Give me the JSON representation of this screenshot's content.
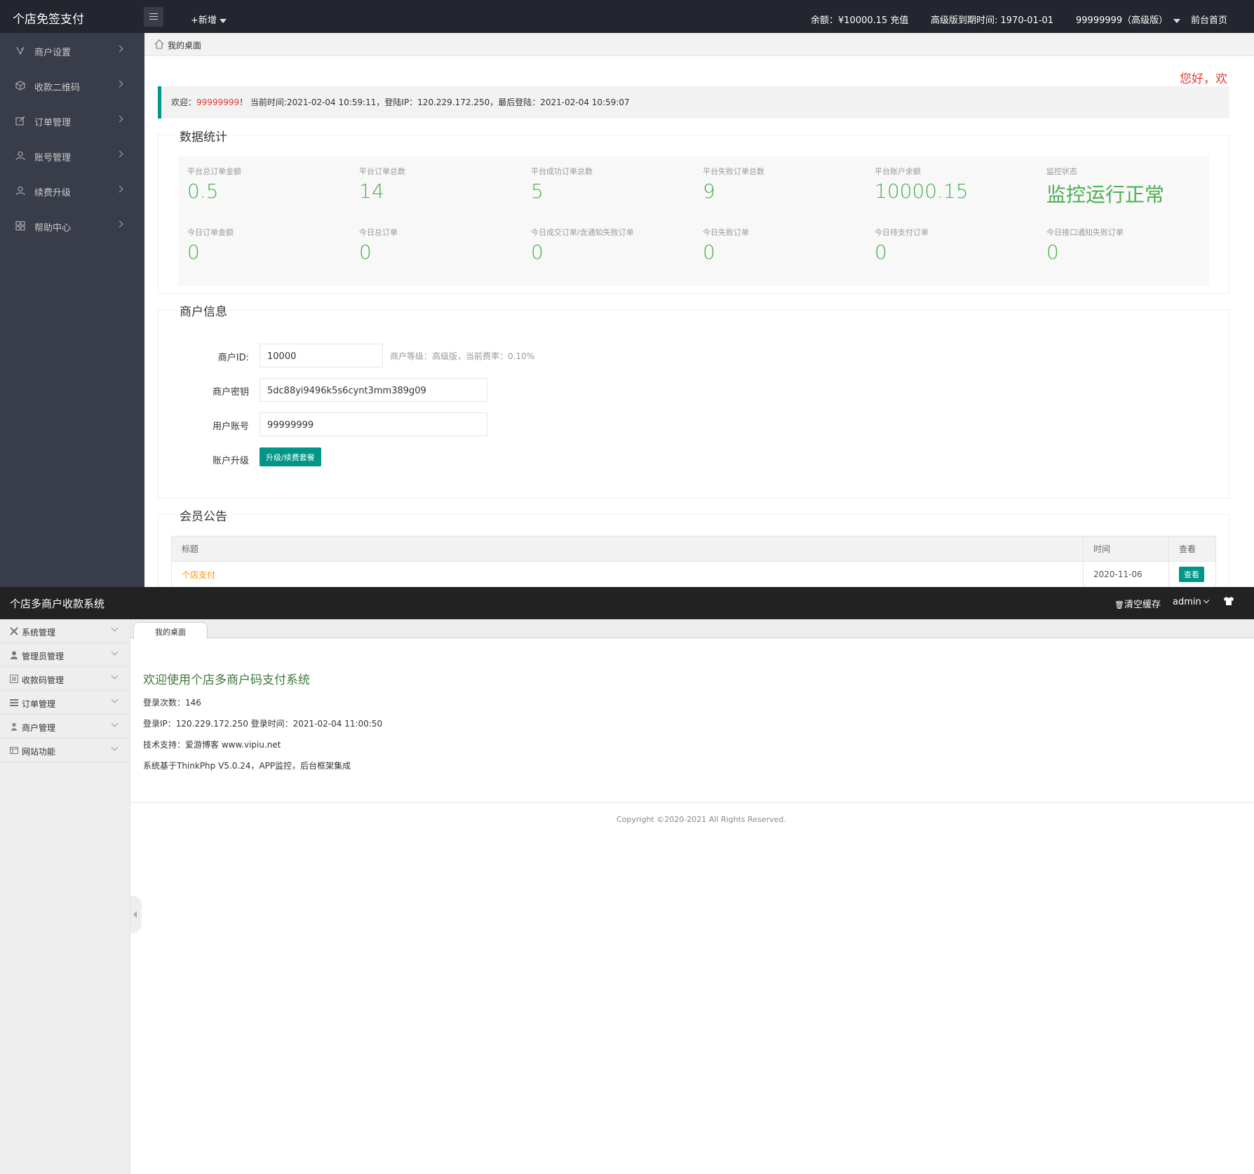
{
  "merchant": {
    "header": {
      "logo": "个店免签支付",
      "new_label": "+新增",
      "balance": "余额：¥10000.15 充值",
      "expiry": "高级版到期时间: 1970-01-01",
      "user": "99999999（高级版）",
      "frontpage": "前台首页"
    },
    "sidebar": [
      {
        "label": "商户设置",
        "icon": "tag-icon"
      },
      {
        "label": "收款二维码",
        "icon": "cube-icon"
      },
      {
        "label": "订单管理",
        "icon": "edit-icon"
      },
      {
        "label": "账号管理",
        "icon": "user-icon"
      },
      {
        "label": "续费升级",
        "icon": "user-icon"
      },
      {
        "label": "帮助中心",
        "icon": "grid-icon"
      }
    ],
    "breadcrumb": "我的桌面",
    "marquee": "您好，欢",
    "welcome": {
      "prefix": "欢迎：",
      "username": "99999999",
      "rest": "！ 当前时间:2021-02-04 10:59:11，登陆IP：120.229.172.250，最后登陆：2021-02-04 10:59:07"
    },
    "stats_title": "数据统计",
    "stats": [
      {
        "label": "平台总订单金额",
        "value": "0.5"
      },
      {
        "label": "平台订单总数",
        "value": "14"
      },
      {
        "label": "平台成功订单总数",
        "value": "5"
      },
      {
        "label": "平台失败订单总数",
        "value": "9"
      },
      {
        "label": "平台账户余额",
        "value": "10000.15"
      },
      {
        "label": "监控状态",
        "value": "监控运行正常"
      },
      {
        "label": "今日订单金额",
        "value": "0"
      },
      {
        "label": "今日总订单",
        "value": "0"
      },
      {
        "label": "今日成交订单/含通知失败订单",
        "value": "0"
      },
      {
        "label": "今日失败订单",
        "value": "0"
      },
      {
        "label": "今日待支付订单",
        "value": "0"
      },
      {
        "label": "今日接口通知失败订单",
        "value": "0"
      }
    ],
    "info_title": "商户信息",
    "info": {
      "id_label": "商户ID:",
      "id_value": "10000",
      "level_note": "商户等级：高级版，当前费率：0.10%",
      "key_label": "商户密钥",
      "key_value": "5dc88yi9496k5s6cynt3mm389g09",
      "account_label": "用户账号",
      "account_value": "99999999",
      "upgrade_label": "账户升级",
      "upgrade_button": "升级/续费套餐"
    },
    "notice_title": "会员公告",
    "notice": {
      "headers": [
        "标题",
        "时间",
        "查看"
      ],
      "rows": [
        {
          "title": "个店支付",
          "time": "2020-11-06",
          "action": "查看"
        }
      ]
    }
  },
  "admin": {
    "header": {
      "logo": "个店多商户收款系统",
      "clear_cache": "清空缓存",
      "user": "admin"
    },
    "sidebar": [
      {
        "label": "系统管理",
        "icon": "tools-icon"
      },
      {
        "label": "管理员管理",
        "icon": "user-icon"
      },
      {
        "label": "收款码管理",
        "icon": "list-icon"
      },
      {
        "label": "订单管理",
        "icon": "list-icon"
      },
      {
        "label": "商户管理",
        "icon": "user-icon"
      },
      {
        "label": "网站功能",
        "icon": "window-icon"
      }
    ],
    "tab": "我的桌面",
    "title": "欢迎使用个店多商户码支付系统",
    "lines": [
      "登录次数：146",
      "登录IP：120.229.172.250 登录时间：2021-02-04 11:00:50",
      "技术支持：爱游博客 www.vipiu.net",
      "系统基于ThinkPhp V5.0.24，APP监控，后台框架集成"
    ],
    "copyright": "Copyright ©2020-2021 All Rights Reserved."
  },
  "colors": {
    "teal": "#009688",
    "green_value": "#4caf50",
    "red": "#e53935",
    "orange": "#ff8f00",
    "dark_header": "#23262e",
    "dark_sidebar": "#393d49"
  }
}
